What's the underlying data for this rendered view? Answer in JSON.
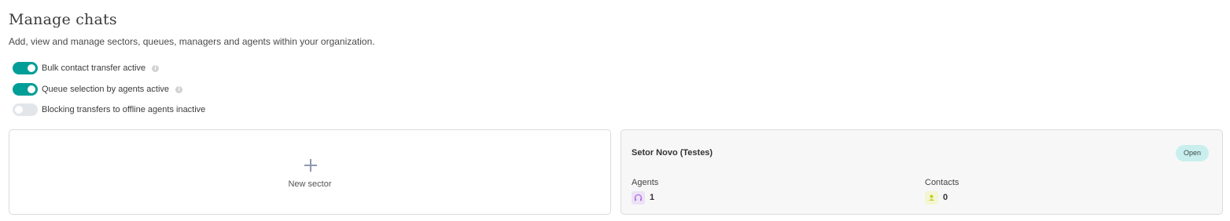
{
  "header": {
    "title": "Manage chats",
    "subtitle": "Add, view and manage sectors, queues, managers and agents within your organization."
  },
  "settings": [
    {
      "label": "Bulk contact transfer active",
      "enabled": true,
      "has_info": true
    },
    {
      "label": "Queue selection by agents active",
      "enabled": true,
      "has_info": true
    },
    {
      "label": "Blocking transfers to offline agents inactive",
      "enabled": false,
      "has_info": false
    }
  ],
  "new_sector": {
    "label": "New sector",
    "icon": "plus-icon"
  },
  "sector": {
    "name": "Setor Novo (Testes)",
    "status": "Open",
    "agents_label": "Agents",
    "agents_count": "1",
    "agents_icon": "headset-icon",
    "contacts_label": "Contacts",
    "contacts_count": "0",
    "contacts_icon": "person-icon"
  },
  "colors": {
    "accent": "#009e96",
    "toggle_off": "#e2e6ea",
    "badge_bg": "#c8efed",
    "agents_icon_color": "#b06fe0",
    "contacts_icon_color": "#c4cc1a"
  }
}
